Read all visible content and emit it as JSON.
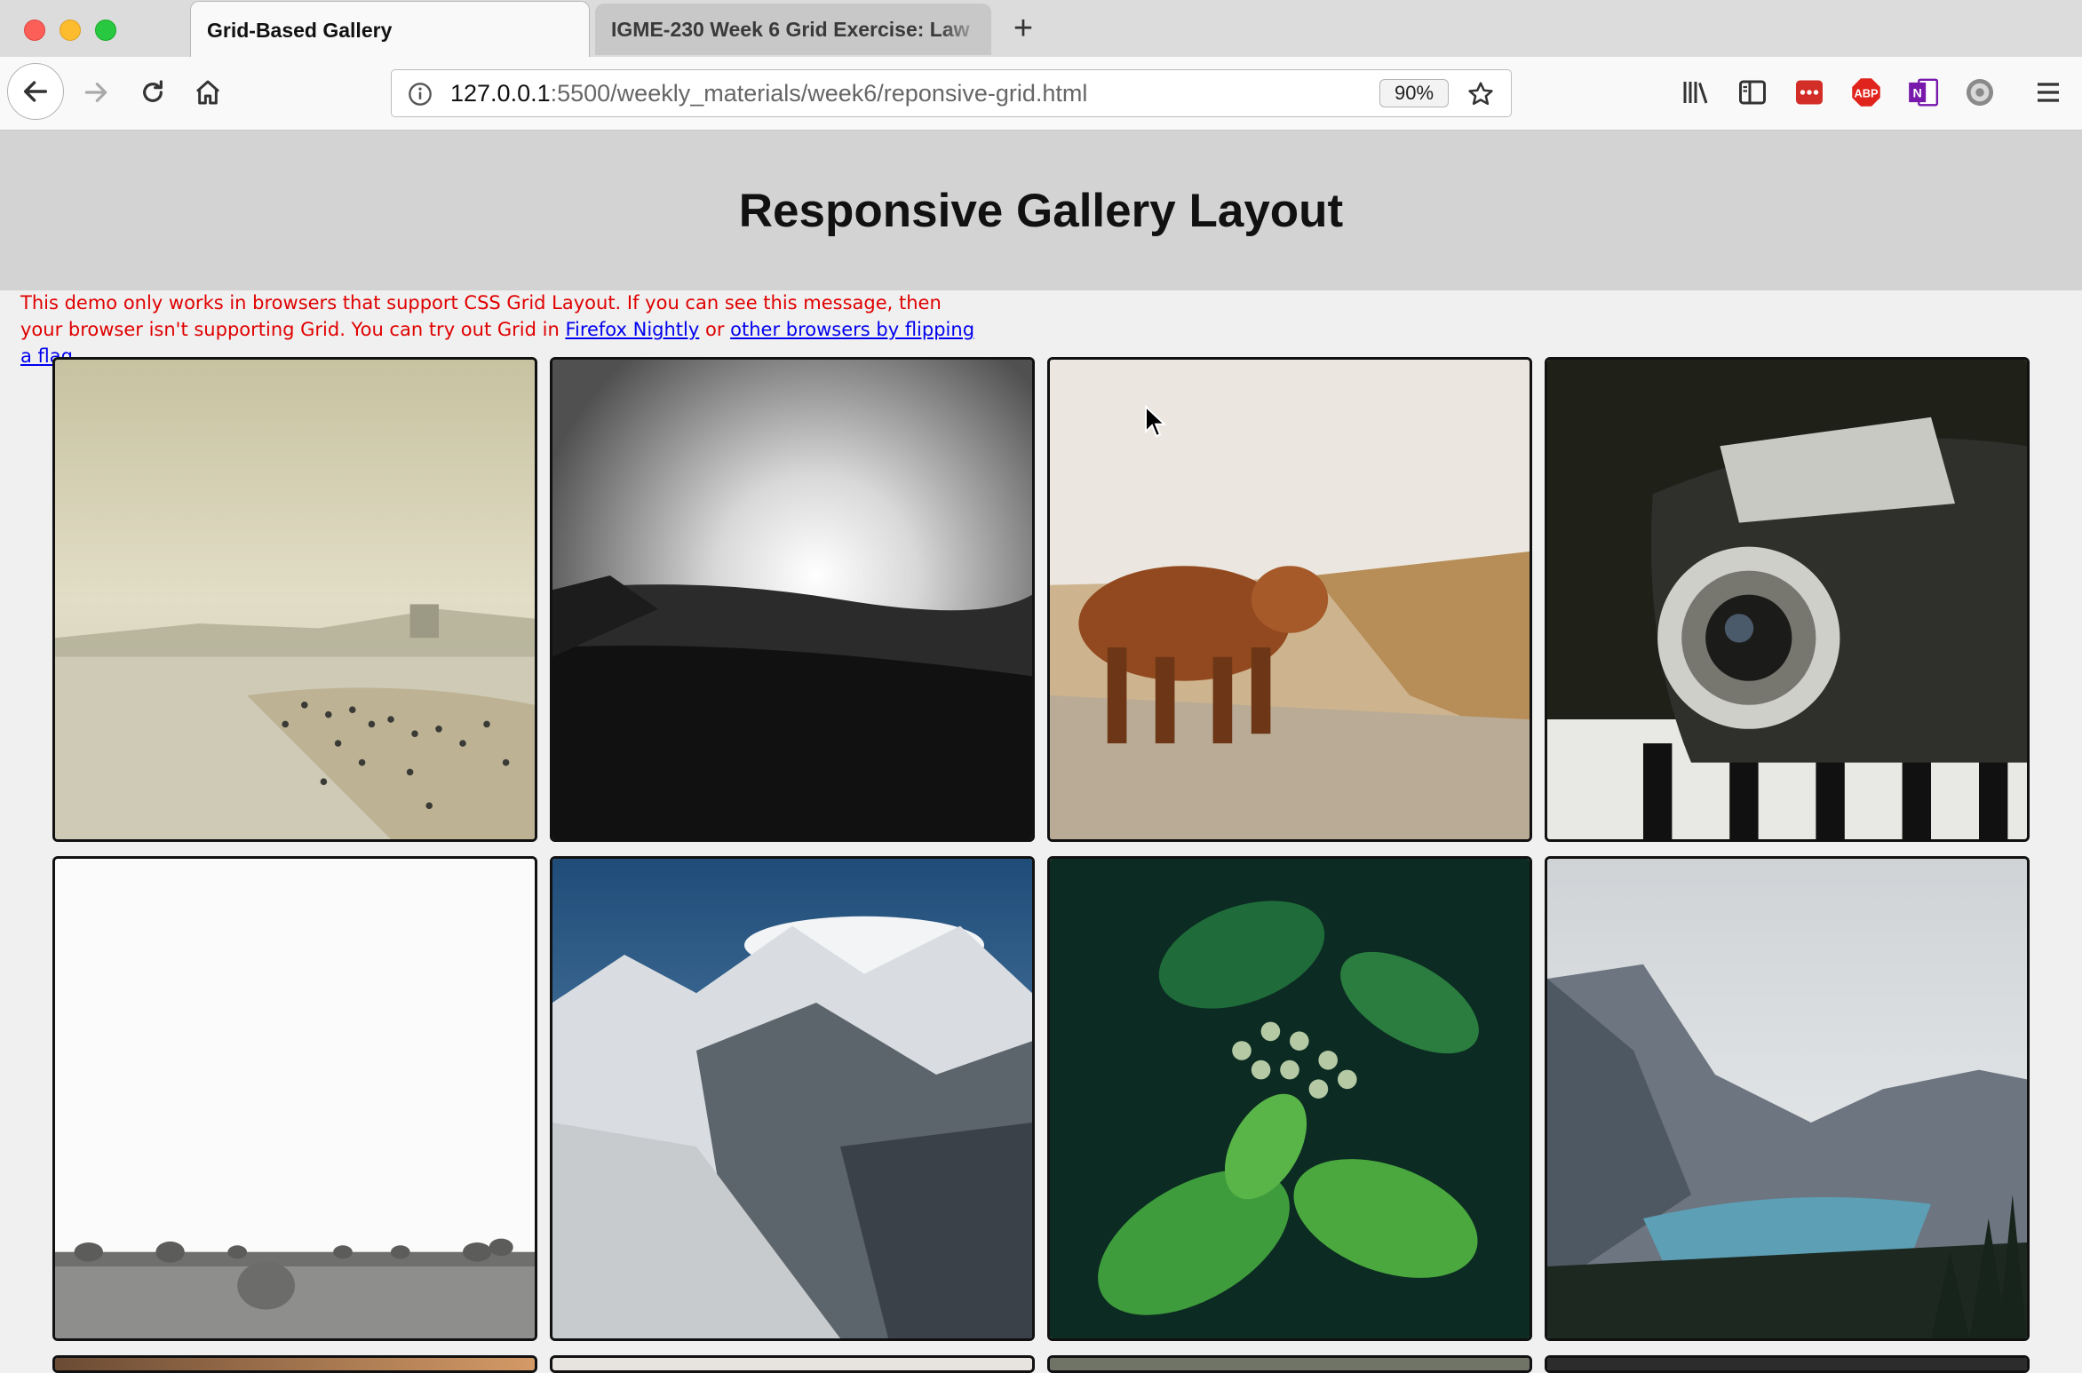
{
  "browser": {
    "tabs": [
      {
        "title": "Grid-Based Gallery",
        "active": true
      },
      {
        "title": "IGME-230 Week 6 Grid Exercise: Law",
        "active": false
      }
    ],
    "url": {
      "host": "127.0.0.1",
      "path": ":5500/weekly_materials/week6/reponsive-grid.html"
    },
    "zoom": "90%",
    "toolbar_icons": [
      "library-icon",
      "sidebar-icon",
      "lastpass-icon",
      "adblock-plus-icon",
      "onenote-icon",
      "settings-gear-icon",
      "hamburger-menu-icon"
    ]
  },
  "page": {
    "title": "Responsive Gallery Layout",
    "warning": {
      "part1": "This demo only works in browsers that support CSS Grid Layout. If you can see this message, then your browser isn't supporting Grid. You can try out Grid in ",
      "link1": "Firefox Nightly",
      "mid": " or ",
      "link2": "other browsers by flipping a flag",
      "end": "."
    },
    "gallery": [
      {
        "name": "beach-photo"
      },
      {
        "name": "black-white-sunset-photo"
      },
      {
        "name": "highland-cow-photo"
      },
      {
        "name": "vintage-camera-photo"
      },
      {
        "name": "hay-bales-photo"
      },
      {
        "name": "snowy-mountains-photo"
      },
      {
        "name": "green-leaves-photo"
      },
      {
        "name": "mountain-lake-photo"
      }
    ]
  },
  "colors": {
    "header_bg": "#d3d3d3",
    "page_bg": "#f0f0f0",
    "warning_text": "#e00000",
    "link": "#0000ee"
  }
}
